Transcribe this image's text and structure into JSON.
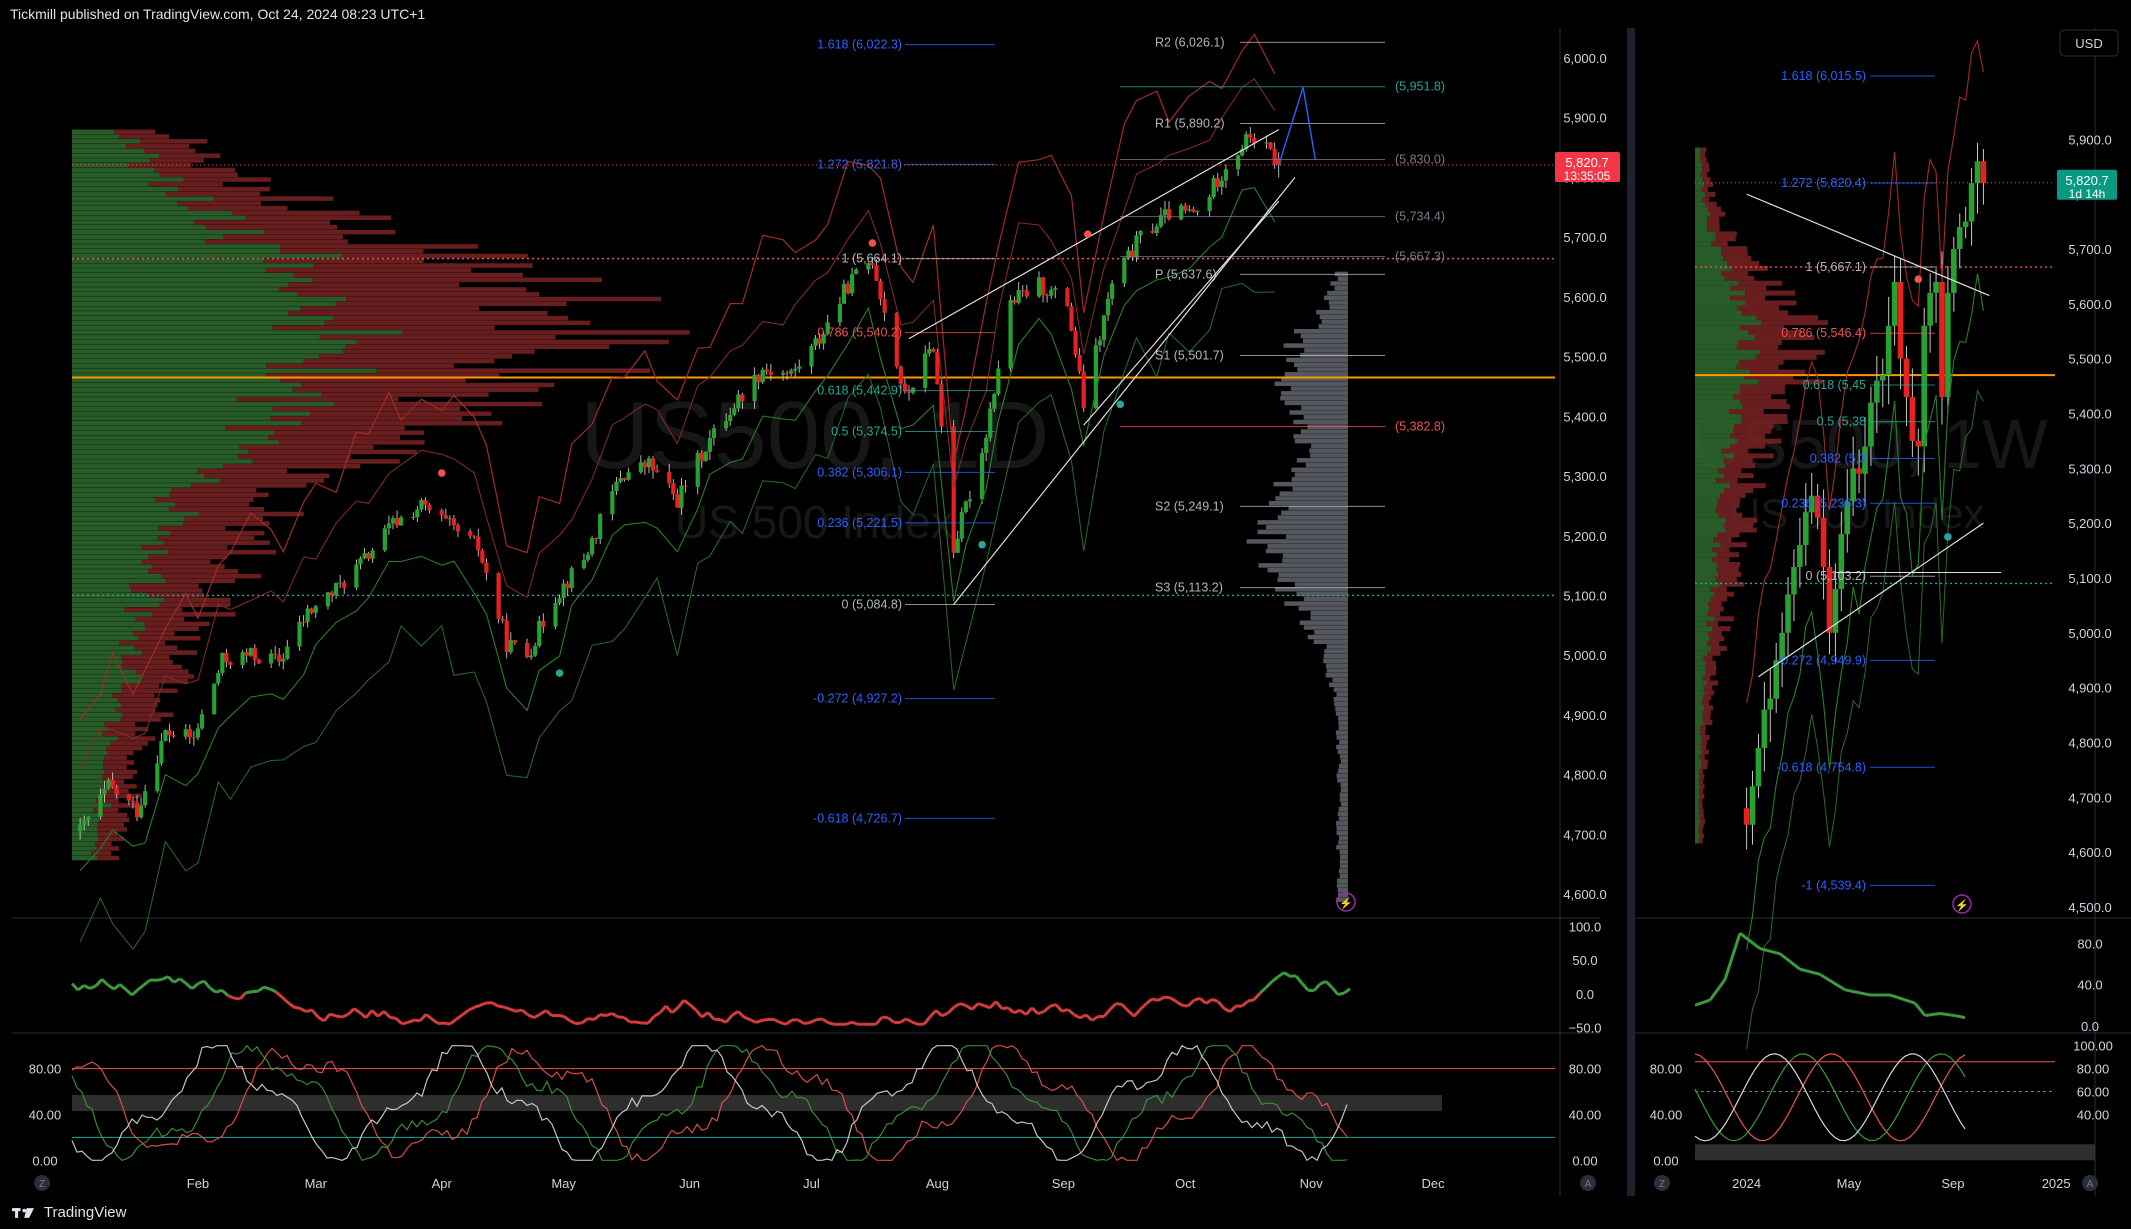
{
  "header": {
    "publisher": "Tickmill published on TradingView.com, Oct 24, 2024 08:23 UTC+1"
  },
  "footer": {
    "brand": "TradingView"
  },
  "colors": {
    "bull": "#26a69a",
    "bullDark": "#2e7d32",
    "bear": "#ef5350",
    "bearDark": "#8b1e1e",
    "fibBlue": "#2962ff",
    "orange": "#ff9800",
    "grid": "#1a1a1a",
    "text": "#b2b5be"
  },
  "chart_data": [
    {
      "type": "candlestick",
      "panel": "daily",
      "watermark": "US500, 1D",
      "watermark_sub": "US 500 Index",
      "ylim": [
        4560,
        6020
      ],
      "y_ticks": [
        "6,000.0",
        "5,900.0",
        "5,800.0",
        "5,700.0",
        "5,600.0",
        "5,500.0",
        "5,400.0",
        "5,300.0",
        "5,200.0",
        "5,100.0",
        "5,000.0",
        "4,900.0",
        "4,800.0",
        "4,700.0",
        "4,600.0"
      ],
      "y_tick_values": [
        6000,
        5900,
        5800,
        5700,
        5600,
        5500,
        5400,
        5300,
        5200,
        5100,
        5000,
        4900,
        4800,
        4700,
        4600
      ],
      "x_labels": [
        "Feb",
        "Mar",
        "Apr",
        "May",
        "Jun",
        "Jul",
        "Aug",
        "Sep",
        "Oct",
        "Nov",
        "Dec"
      ],
      "x_label_dates": [
        "2024-02-01",
        "2024-03-01",
        "2024-04-01",
        "2024-05-01",
        "2024-06-01",
        "2024-07-01",
        "2024-08-01",
        "2024-09-01",
        "2024-10-01",
        "2024-11-01",
        "2024-12-01"
      ],
      "x_range": [
        "2024-01-01",
        "2024-12-31"
      ],
      "last_price": {
        "value": 5820.7,
        "label": "5,820.7",
        "countdown": "13:35:05"
      },
      "close_path": [
        {
          "d": "2024-01-03",
          "c": 4705
        },
        {
          "d": "2024-01-10",
          "c": 4780
        },
        {
          "d": "2024-01-17",
          "c": 4740
        },
        {
          "d": "2024-01-24",
          "c": 4870
        },
        {
          "d": "2024-01-31",
          "c": 4860
        },
        {
          "d": "2024-02-07",
          "c": 4990
        },
        {
          "d": "2024-02-14",
          "c": 5000
        },
        {
          "d": "2024-02-21",
          "c": 4990
        },
        {
          "d": "2024-02-28",
          "c": 5070
        },
        {
          "d": "2024-03-06",
          "c": 5110
        },
        {
          "d": "2024-03-13",
          "c": 5160
        },
        {
          "d": "2024-03-20",
          "c": 5220
        },
        {
          "d": "2024-03-27",
          "c": 5250
        },
        {
          "d": "2024-04-03",
          "c": 5215
        },
        {
          "d": "2024-04-10",
          "c": 5180
        },
        {
          "d": "2024-04-17",
          "c": 5020
        },
        {
          "d": "2024-04-22",
          "c": 5000
        },
        {
          "d": "2024-04-29",
          "c": 5100
        },
        {
          "d": "2024-05-06",
          "c": 5160
        },
        {
          "d": "2024-05-15",
          "c": 5300
        },
        {
          "d": "2024-05-22",
          "c": 5320
        },
        {
          "d": "2024-05-29",
          "c": 5260
        },
        {
          "d": "2024-06-05",
          "c": 5350
        },
        {
          "d": "2024-06-12",
          "c": 5420
        },
        {
          "d": "2024-06-19",
          "c": 5480
        },
        {
          "d": "2024-06-26",
          "c": 5470
        },
        {
          "d": "2024-07-03",
          "c": 5530
        },
        {
          "d": "2024-07-10",
          "c": 5620
        },
        {
          "d": "2024-07-16",
          "c": 5664
        },
        {
          "d": "2024-07-24",
          "c": 5430
        },
        {
          "d": "2024-07-31",
          "c": 5520
        },
        {
          "d": "2024-08-05",
          "c": 5180
        },
        {
          "d": "2024-08-12",
          "c": 5340
        },
        {
          "d": "2024-08-19",
          "c": 5590
        },
        {
          "d": "2024-08-26",
          "c": 5620
        },
        {
          "d": "2024-09-02",
          "c": 5590
        },
        {
          "d": "2024-09-06",
          "c": 5420
        },
        {
          "d": "2024-09-13",
          "c": 5620
        },
        {
          "d": "2024-09-20",
          "c": 5700
        },
        {
          "d": "2024-09-27",
          "c": 5740
        },
        {
          "d": "2024-10-04",
          "c": 5740
        },
        {
          "d": "2024-10-11",
          "c": 5820
        },
        {
          "d": "2024-10-17",
          "c": 5870
        },
        {
          "d": "2024-10-22",
          "c": 5840
        },
        {
          "d": "2024-10-24",
          "c": 5820
        }
      ],
      "fib_levels": [
        {
          "label": "1.618 (6,022.3)",
          "value": 6022.3,
          "color": "#2962ff"
        },
        {
          "label": "1.272 (5,821.8)",
          "value": 5821.8,
          "color": "#2962ff"
        },
        {
          "label": "1 (5,664.1)",
          "value": 5664.1,
          "color": "#b2b5be"
        },
        {
          "label": "0.786 (5,540.2)",
          "value": 5540.2,
          "color": "#ef5350"
        },
        {
          "label": "0.618 (5,442.9)",
          "value": 5442.9,
          "color": "#26a69a"
        },
        {
          "label": "0.5 (5,374.5)",
          "value": 5374.5,
          "color": "#26a69a"
        },
        {
          "label": "0.382 (5,306.1)",
          "value": 5306.1,
          "color": "#2962ff"
        },
        {
          "label": "0.236 (5,221.5)",
          "value": 5221.5,
          "color": "#2962ff"
        },
        {
          "label": "0 (5,084.8)",
          "value": 5084.8,
          "color": "#b2b5be"
        },
        {
          "label": "-0.272 (4,927.2)",
          "value": 4927.2,
          "color": "#2962ff"
        },
        {
          "label": "-0.618 (4,726.7)",
          "value": 4726.7,
          "color": "#2962ff"
        }
      ],
      "pivot_levels": [
        {
          "label": "R2 (6,026.1)",
          "value": 6026.1
        },
        {
          "label": "R1 (5,890.2)",
          "value": 5890.2
        },
        {
          "label": "P (5,637.6)",
          "value": 5637.6
        },
        {
          "label": "S1 (5,501.7)",
          "value": 5501.7
        },
        {
          "label": "S2 (5,249.1)",
          "value": 5249.1
        },
        {
          "label": "S3 (5,113.2)",
          "value": 5113.2
        }
      ],
      "right_levels": [
        {
          "label": "(5,951.8)",
          "value": 5951.8,
          "color": "#26a69a"
        },
        {
          "label": "(5,830.0)",
          "value": 5830.0,
          "color": "#787b86"
        },
        {
          "label": "(5,734.4)",
          "value": 5734.4,
          "color": "#787b86"
        },
        {
          "label": "(5,667.3)",
          "value": 5667.3,
          "color": "#787b86"
        },
        {
          "label": "(5,382.8)",
          "value": 5382.8,
          "color": "#ef5350"
        }
      ],
      "hlines": [
        {
          "value": 5664,
          "style": "dotted",
          "color": "#ef5350"
        },
        {
          "value": 5465,
          "style": "solid",
          "color": "#ff9800"
        },
        {
          "value": 5100,
          "style": "dotted",
          "color": "#26a69a"
        }
      ],
      "oscillator_1": {
        "ticks": [
          "100.0",
          "50.0",
          "0.0",
          "−50.0"
        ],
        "tick_values": [
          100,
          50,
          0,
          -50
        ],
        "ylim": [
          -55,
          105
        ]
      },
      "oscillator_2": {
        "ticks": [
          "80.00",
          "40.00",
          "0.00"
        ],
        "tick_values": [
          80,
          40,
          0
        ],
        "ylim": [
          -5,
          105
        ]
      }
    },
    {
      "type": "candlestick",
      "panel": "weekly",
      "watermark": "US500, 1W",
      "watermark_sub": "US 500 Index",
      "currency": "USD",
      "ylim": [
        4480,
        6030
      ],
      "y_ticks": [
        "5,900.0",
        "5,800.0",
        "5,700.0",
        "5,600.0",
        "5,500.0",
        "5,400.0",
        "5,300.0",
        "5,200.0",
        "5,100.0",
        "5,000.0",
        "4,900.0",
        "4,800.0",
        "4,700.0",
        "4,600.0",
        "4,500.0"
      ],
      "y_tick_values": [
        5900,
        5800,
        5700,
        5600,
        5500,
        5400,
        5300,
        5200,
        5100,
        5000,
        4900,
        4800,
        4700,
        4600,
        4500
      ],
      "x_labels": [
        "2024",
        "May",
        "Sep",
        "2025"
      ],
      "x_label_dates": [
        "2024-01-01",
        "2024-05-01",
        "2024-09-01",
        "2025-01-01"
      ],
      "x_range": [
        "2023-11-01",
        "2025-02-10"
      ],
      "last_price": {
        "value": 5820.7,
        "label": "5,820.7",
        "countdown": "1d 14h"
      },
      "weekly_closes": [
        4650,
        4720,
        4790,
        4860,
        4880,
        4950,
        5000,
        5070,
        5120,
        5160,
        5220,
        5250,
        5210,
        5120,
        5000,
        5080,
        5180,
        5240,
        5300,
        5290,
        5340,
        5420,
        5460,
        5470,
        5560,
        5640,
        5500,
        5430,
        5350,
        5340,
        5560,
        5620,
        5640,
        5430,
        5620,
        5700,
        5740,
        5750,
        5820,
        5860,
        5820
      ],
      "weekly_start": "2024-01-01",
      "fib_levels": [
        {
          "label": "1.618 (6,015.5)",
          "value": 6015.5,
          "color": "#2962ff"
        },
        {
          "label": "1.272 (5,820.4)",
          "value": 5820.4,
          "color": "#2962ff"
        },
        {
          "label": "1 (5,667.1)",
          "value": 5667.1,
          "color": "#b2b5be"
        },
        {
          "label": "0.786 (5,546.4)",
          "value": 5546.4,
          "color": "#ef5350"
        },
        {
          "label": "0.618 (5,45",
          "value": 5452.0,
          "color": "#26a69a"
        },
        {
          "label": "0.5 (5,38",
          "value": 5385.0,
          "color": "#26a69a"
        },
        {
          "label": "0.382 (5,3",
          "value": 5318.0,
          "color": "#2962ff"
        },
        {
          "label": "0.236 (5,236.3)",
          "value": 5236.3,
          "color": "#2962ff"
        },
        {
          "label": "0 (5,103.2)",
          "value": 5103.2,
          "color": "#b2b5be"
        },
        {
          "label": "-0.272 (4,949.9)",
          "value": 4949.9,
          "color": "#2962ff"
        },
        {
          "label": "-0.618 (4,754.8)",
          "value": 4754.8,
          "color": "#2962ff"
        },
        {
          "label": "-1 (4,539.4)",
          "value": 4539.4,
          "color": "#2962ff"
        }
      ],
      "hlines": [
        {
          "value": 5667,
          "style": "dotted",
          "color": "#ef5350"
        },
        {
          "value": 5470,
          "style": "solid",
          "color": "#ff9800"
        },
        {
          "value": 5090,
          "style": "dotted",
          "color": "#26a69a"
        }
      ],
      "oscillator_1": {
        "ticks": [
          "80.0",
          "40.0",
          "0.0"
        ],
        "tick_values": [
          80,
          40,
          0
        ],
        "ylim": [
          -5,
          95
        ]
      },
      "oscillator_2": {
        "ticks": [
          "100.00",
          "80.00",
          "60.00",
          "40.00"
        ],
        "tick_values": [
          100,
          80,
          60,
          40
        ],
        "ticks_left": [
          "80.00",
          "40.00",
          "0.00"
        ],
        "tick_values_left": [
          80,
          40,
          0
        ],
        "ylim": [
          -5,
          105
        ]
      }
    }
  ]
}
